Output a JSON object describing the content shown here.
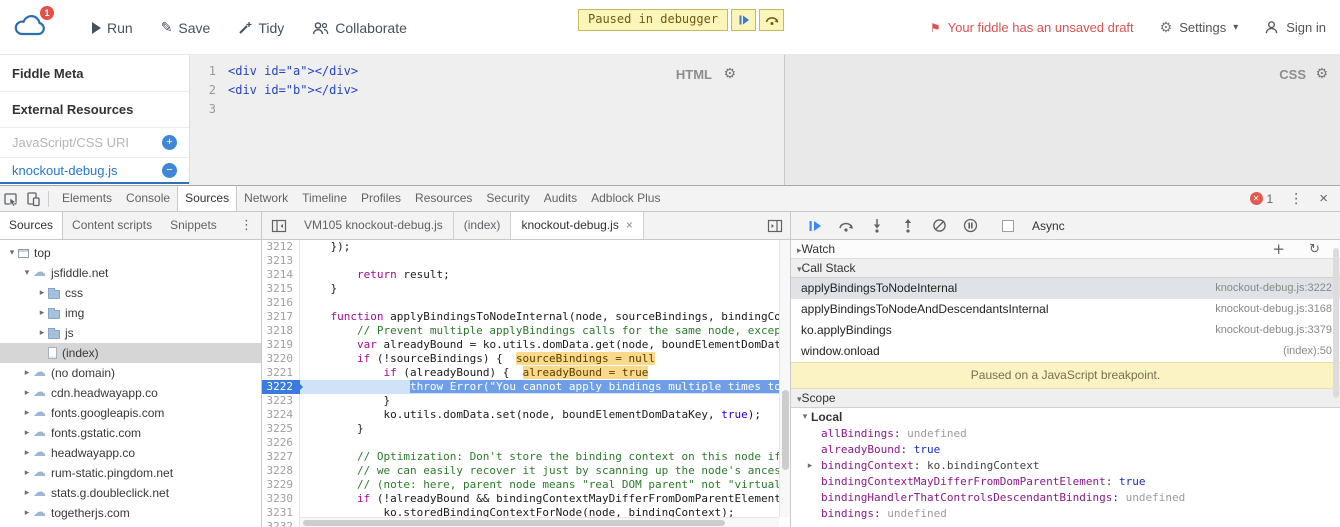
{
  "jsfiddle": {
    "badge": "1",
    "nav": {
      "run": "Run",
      "save": "Save",
      "tidy": "Tidy",
      "collaborate": "Collaborate"
    },
    "paused_badge": "Paused in debugger",
    "draft_notice": "Your fiddle has an unsaved draft",
    "settings": "Settings",
    "signin": "Sign in",
    "sidebar": {
      "meta": "Fiddle Meta",
      "external": "External Resources",
      "uri": "JavaScript/CSS URI",
      "resource": "knockout-debug.js"
    },
    "html_editor": {
      "label": "HTML",
      "lines": [
        {
          "num": "1",
          "code": "<div id=\"a\"></div>"
        },
        {
          "num": "2",
          "code": "<div id=\"b\"></div>"
        },
        {
          "num": "3",
          "code": ""
        }
      ]
    },
    "css_editor": {
      "label": "CSS"
    }
  },
  "devtools": {
    "main_tabs": [
      "Elements",
      "Console",
      "Sources",
      "Network",
      "Timeline",
      "Profiles",
      "Resources",
      "Security",
      "Audits",
      "Adblock Plus"
    ],
    "active_tab": "Sources",
    "error_count": "1",
    "nav_tabs": [
      "Sources",
      "Content scripts",
      "Snippets"
    ],
    "nav_active": "Sources",
    "tree": [
      {
        "label": "top",
        "icon": "frame",
        "arrow": "open",
        "depth": 0
      },
      {
        "label": "jsfiddle.net",
        "icon": "cloud",
        "arrow": "open",
        "depth": 1
      },
      {
        "label": "css",
        "icon": "folder",
        "arrow": "closed",
        "depth": 2
      },
      {
        "label": "img",
        "icon": "folder",
        "arrow": "closed",
        "depth": 2
      },
      {
        "label": "js",
        "icon": "folder",
        "arrow": "closed",
        "depth": 2
      },
      {
        "label": "(index)",
        "icon": "file",
        "arrow": "none",
        "depth": 2,
        "selected": true
      },
      {
        "label": "(no domain)",
        "icon": "cloud",
        "arrow": "closed",
        "depth": 1
      },
      {
        "label": "cdn.headwayapp.co",
        "icon": "cloud",
        "arrow": "closed",
        "depth": 1
      },
      {
        "label": "fonts.googleapis.com",
        "icon": "cloud",
        "arrow": "closed",
        "depth": 1
      },
      {
        "label": "fonts.gstatic.com",
        "icon": "cloud",
        "arrow": "closed",
        "depth": 1
      },
      {
        "label": "headwayapp.co",
        "icon": "cloud",
        "arrow": "closed",
        "depth": 1
      },
      {
        "label": "rum-static.pingdom.net",
        "icon": "cloud",
        "arrow": "closed",
        "depth": 1
      },
      {
        "label": "stats.g.doubleclick.net",
        "icon": "cloud",
        "arrow": "closed",
        "depth": 1
      },
      {
        "label": "togetherjs.com",
        "icon": "cloud",
        "arrow": "closed",
        "depth": 1
      }
    ],
    "editor_tabs": [
      {
        "label": "VM105 knockout-debug.js"
      },
      {
        "label": "(index)"
      },
      {
        "label": "knockout-debug.js",
        "active": true,
        "close": true
      }
    ],
    "code_lines": [
      {
        "n": "3212",
        "t": [
          [
            "plain",
            "    });"
          ]
        ]
      },
      {
        "n": "3213",
        "t": []
      },
      {
        "n": "3214",
        "t": [
          [
            "plain",
            "        "
          ],
          [
            "keyword",
            "return"
          ],
          [
            "plain",
            " result;"
          ]
        ]
      },
      {
        "n": "3215",
        "t": [
          [
            "plain",
            "    }"
          ]
        ]
      },
      {
        "n": "3216",
        "t": []
      },
      {
        "n": "3217",
        "t": [
          [
            "plain",
            "    "
          ],
          [
            "keyword",
            "function"
          ],
          [
            "plain",
            " applyBindingsToNodeInternal(node, sourceBindings, bindingCont"
          ]
        ]
      },
      {
        "n": "3218",
        "t": [
          [
            "comment",
            "        // Prevent multiple applyBindings calls for the same node, except "
          ]
        ]
      },
      {
        "n": "3219",
        "t": [
          [
            "plain",
            "        "
          ],
          [
            "keyword",
            "var"
          ],
          [
            "plain",
            " alreadyBound = ko.utils.domData.get(node, boundElementDomData"
          ]
        ]
      },
      {
        "n": "3220",
        "t": [
          [
            "plain",
            "        "
          ],
          [
            "keyword",
            "if"
          ],
          [
            "plain",
            " (!sourceBindings) {  "
          ],
          [
            "inline",
            "sourceBindings = null"
          ]
        ]
      },
      {
        "n": "3221",
        "t": [
          [
            "plain",
            "            "
          ],
          [
            "keyword",
            "if"
          ],
          [
            "plain",
            " (alreadyBound) {  "
          ],
          [
            "inline",
            "alreadyBound = true"
          ]
        ]
      },
      {
        "n": "3222",
        "exec": true,
        "t": [
          [
            "plain",
            "                "
          ],
          [
            "xkeyword",
            "throw"
          ],
          [
            "xplain",
            " Error("
          ],
          [
            "xstring",
            "\"You cannot apply bindings multiple times to"
          ]
        ]
      },
      {
        "n": "3223",
        "t": [
          [
            "plain",
            "            }"
          ]
        ]
      },
      {
        "n": "3224",
        "t": [
          [
            "plain",
            "            ko.utils.domData.set(node, boundElementDomDataKey, "
          ],
          [
            "atom",
            "true"
          ],
          [
            "plain",
            ");"
          ]
        ]
      },
      {
        "n": "3225",
        "t": [
          [
            "plain",
            "        }"
          ]
        ]
      },
      {
        "n": "3226",
        "t": []
      },
      {
        "n": "3227",
        "t": [
          [
            "comment",
            "        // Optimization: Don't store the binding context on this node if"
          ]
        ]
      },
      {
        "n": "3228",
        "t": [
          [
            "comment",
            "        // we can easily recover it just by scanning up the node's ances"
          ]
        ]
      },
      {
        "n": "3229",
        "t": [
          [
            "comment",
            "        // (note: here, parent node means \"real DOM parent\" not \"virtual"
          ]
        ]
      },
      {
        "n": "3230",
        "t": [
          [
            "plain",
            "        "
          ],
          [
            "keyword",
            "if"
          ],
          [
            "plain",
            " (!alreadyBound && bindingContextMayDifferFromDomParentElement"
          ]
        ]
      },
      {
        "n": "3231",
        "t": [
          [
            "plain",
            "            ko.storedBindingContextForNode(node, bindingContext);"
          ]
        ]
      },
      {
        "n": "3232",
        "t": []
      }
    ],
    "debugger": {
      "async": "Async",
      "watch": "Watch",
      "callstack_title": "Call Stack",
      "frames": [
        {
          "fn": "applyBindingsToNodeInternal",
          "loc": "knockout-debug.js:3222",
          "selected": true
        },
        {
          "fn": "applyBindingsToNodeAndDescendantsInternal",
          "loc": "knockout-debug.js:3168"
        },
        {
          "fn": "ko.applyBindings",
          "loc": "knockout-debug.js:3379"
        },
        {
          "fn": "window.onload",
          "loc": "(index):50"
        }
      ],
      "paused": "Paused on a JavaScript breakpoint.",
      "scope_title": "Scope",
      "local": "Local",
      "vars": [
        {
          "name": "allBindings",
          "value": "undefined",
          "kind": "undefined"
        },
        {
          "name": "alreadyBound",
          "value": "true",
          "kind": "boolean"
        },
        {
          "name": "bindingContext",
          "value": "ko.bindingContext",
          "kind": "object",
          "expandable": true
        },
        {
          "name": "bindingContextMayDifferFromDomParentElement",
          "value": "true",
          "kind": "boolean"
        },
        {
          "name": "bindingHandlerThatControlsDescendantBindings",
          "value": "undefined",
          "kind": "undefined"
        },
        {
          "name": "bindings",
          "value": "undefined",
          "kind": "undefined"
        }
      ]
    }
  }
}
